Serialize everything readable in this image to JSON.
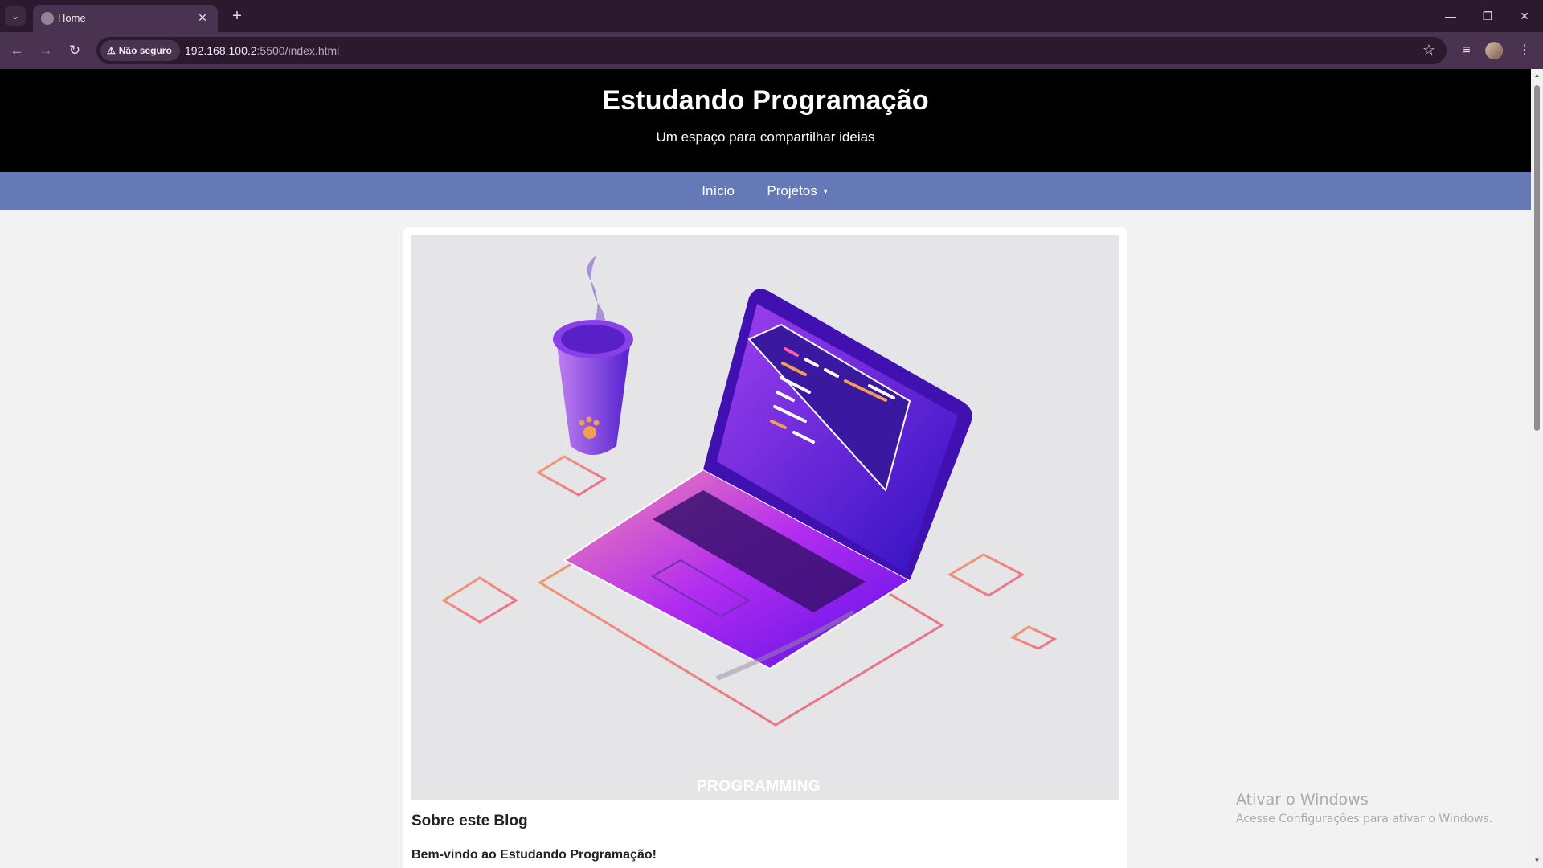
{
  "browser": {
    "tab_title": "Home",
    "security_label": "Não seguro",
    "url_host": "192.168.100.2",
    "url_rest": ":5500/index.html"
  },
  "site": {
    "title": "Estudando Programação",
    "subtitle": "Um espaço para compartilhar ideias",
    "nav": {
      "home": "Início",
      "projects": "Projetos"
    },
    "hero_caption": "PROGRAMMING",
    "about_heading": "Sobre este Blog",
    "welcome_text": "Bem-vindo ao Estudando Programação!"
  },
  "watermark": {
    "title": "Ativar o Windows",
    "subtitle": "Acesse Configurações para ativar o Windows."
  },
  "colors": {
    "header_bg": "#000000",
    "nav_bg": "#6479b6",
    "hero_bg": "#e5e5e7",
    "accent_purple": "#7a1fe6"
  },
  "icons": [
    "tab-list-icon",
    "globe-icon",
    "close-icon",
    "plus-icon",
    "minimize-icon",
    "restore-icon",
    "back-icon",
    "forward-icon",
    "reload-icon",
    "warning-icon",
    "star-icon",
    "media-icon",
    "menu-icon"
  ]
}
